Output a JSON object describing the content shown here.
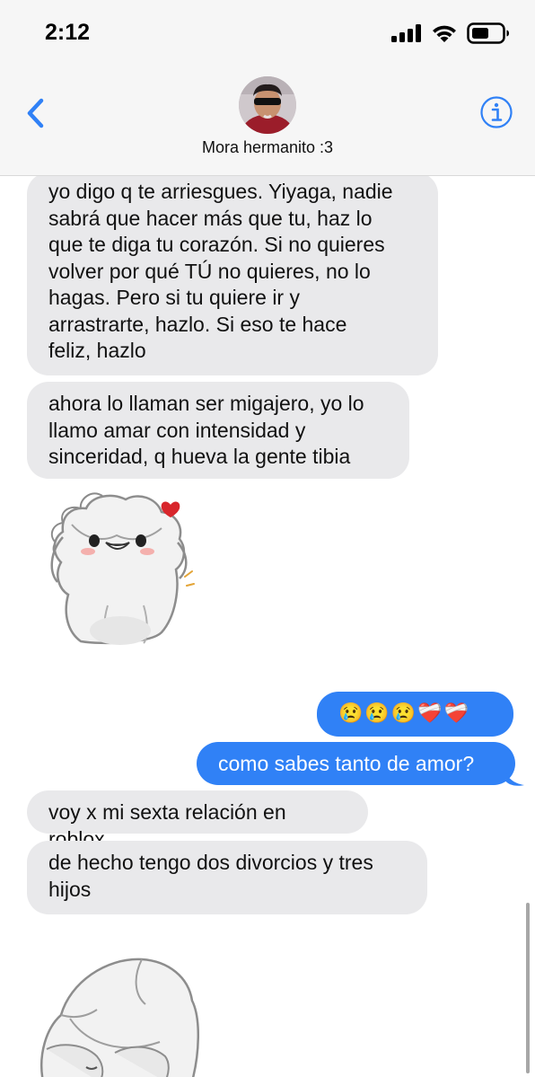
{
  "status_bar": {
    "time": "2:12",
    "icons": [
      "signal-icon",
      "wifi-icon",
      "battery-icon"
    ]
  },
  "nav": {
    "back_icon": "chevron-left-icon",
    "info_icon": "info-icon",
    "contact_name": "Mora hermanito :3"
  },
  "colors": {
    "accent": "#3081f6",
    "incoming_bubble": "#e9e9eb",
    "header_bg": "#f6f6f6"
  },
  "messages": [
    {
      "direction": "in",
      "lines": [
        "yo digo q te arriesgues. Yiyaga, nadie",
        "sabrá que hacer más que tu, haz lo",
        "que te diga tu corazón. Si no quieres",
        "volver por qué TÚ no quieres, no lo",
        "hagas. Pero si tu quiere ir y",
        "arrastrarte, hazlo. Si eso te hace",
        "feliz, hazlo"
      ]
    },
    {
      "direction": "in",
      "lines": [
        "ahora lo llaman ser migajero, yo lo",
        "llamo amar con intensidad y",
        "sinceridad, q hueva la gente tibia"
      ]
    },
    {
      "direction": "in",
      "type": "sticker",
      "sticker": "white-dog-heart-sticker"
    },
    {
      "direction": "out",
      "text": "😢😢😢❤️‍🩹❤️‍🩹"
    },
    {
      "direction": "out",
      "text": "como sabes tanto de amor?"
    },
    {
      "direction": "in",
      "lines": [
        "voy x mi sexta relación en roblox"
      ]
    },
    {
      "direction": "in",
      "lines": [
        "de hecho tengo dos divorcios y tres",
        "hijos"
      ]
    },
    {
      "direction": "in",
      "type": "sticker",
      "sticker": "white-dog-sad-sticker"
    }
  ]
}
